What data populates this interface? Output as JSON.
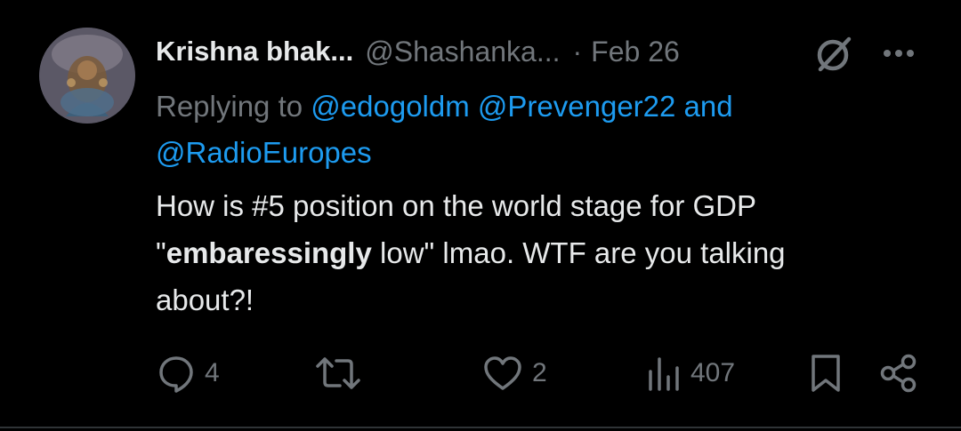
{
  "post": {
    "author": {
      "display_name": "Krishna bhak...",
      "handle": "@Shashanka...",
      "separator": "·",
      "date": "Feb 26"
    },
    "replying_to": {
      "prefix": "Replying to",
      "mentions": [
        "@edogoldm",
        "@Prevenger22"
      ],
      "conjunction": "and",
      "last_mention": "@RadioEuropes"
    },
    "body": {
      "line1": "How is #5 position on the world stage for GDP",
      "quote_open": "\"",
      "bold_word": "embaressingly",
      "line2_rest": " low\" lmao. WTF are you talking",
      "line3": "about?!"
    },
    "actions": {
      "replies": "4",
      "reposts": "",
      "likes": "2",
      "views": "407"
    },
    "icons": {
      "grok": "grok-icon",
      "more": "more-dots-icon",
      "reply": "reply-bubble-icon",
      "repost": "repost-icon",
      "like": "heart-icon",
      "views": "views-chart-icon",
      "bookmark": "bookmark-icon",
      "share": "share-icon"
    }
  },
  "colors": {
    "background": "#000000",
    "text_primary": "#e7e9ea",
    "text_secondary": "#71767b",
    "mention": "#1d9bf0",
    "divider": "#2f3336"
  }
}
